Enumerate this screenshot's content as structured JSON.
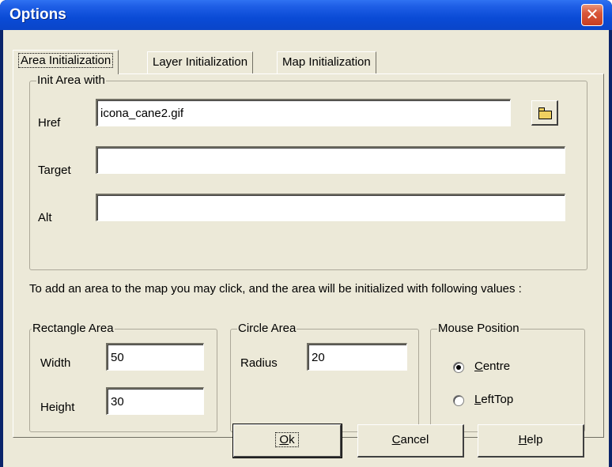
{
  "window": {
    "title": "Options",
    "close_glyph": "✕"
  },
  "tabs": [
    {
      "label": "Area Initialization",
      "active": true
    },
    {
      "label": "Layer Initialization",
      "active": false
    },
    {
      "label": "Map Initialization",
      "active": false
    }
  ],
  "init_area": {
    "legend": "Init Area with",
    "href_label": "Href",
    "href_value": "icona_cane2.gif",
    "target_label": "Target",
    "target_value": "",
    "alt_label": "Alt",
    "alt_value": "",
    "browse_icon": "open-folder-icon"
  },
  "info_text": "To add an area to the map you may click, and the area will be initialized with following values :",
  "rectangle_area": {
    "legend": "Rectangle Area",
    "width_label": "Width",
    "width_value": "50",
    "height_label": "Height",
    "height_value": "30"
  },
  "circle_area": {
    "legend": "Circle Area",
    "radius_label": "Radius",
    "radius_value": "20"
  },
  "mouse_position": {
    "legend": "Mouse Position",
    "options": [
      {
        "label": "Centre",
        "accel": "C",
        "rest": "entre",
        "checked": true
      },
      {
        "label": "LeftTop",
        "accel": "L",
        "rest": "eftTop",
        "checked": false
      }
    ]
  },
  "buttons": {
    "ok": {
      "accel": "O",
      "rest": "k"
    },
    "cancel": {
      "accel": "C",
      "rest": "ancel"
    },
    "help": {
      "accel": "H",
      "rest": "elp"
    }
  },
  "colors": {
    "titlebar": "#0a4bd6",
    "dialog_bg": "#ece9d8",
    "close_button": "#d9573a"
  }
}
